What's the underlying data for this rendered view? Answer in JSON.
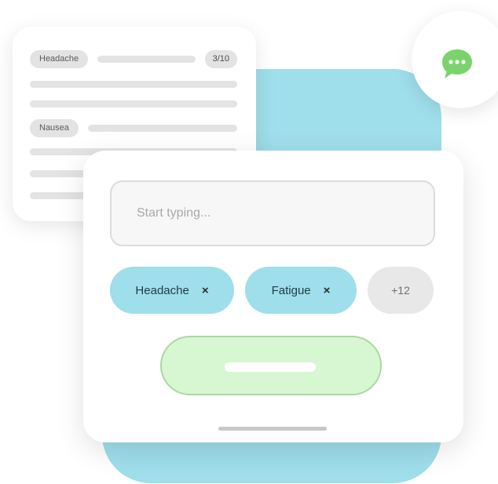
{
  "symptom_list": {
    "items": [
      {
        "label": "Headache",
        "score": "3/10"
      },
      {
        "label": "Nausea"
      }
    ]
  },
  "chat": {
    "icon": "chat-bubble-icon",
    "icon_color": "#7bd36d"
  },
  "input_card": {
    "search_placeholder": "Start typing...",
    "search_value": "",
    "chips": [
      {
        "label": "Headache",
        "remove": "×"
      },
      {
        "label": "Fatigue",
        "remove": "×"
      }
    ],
    "more_count": "+12"
  },
  "colors": {
    "accent_blue": "#9fdeeb",
    "accent_green": "#d7f7d2",
    "chip_gray": "#e8e8e8"
  }
}
